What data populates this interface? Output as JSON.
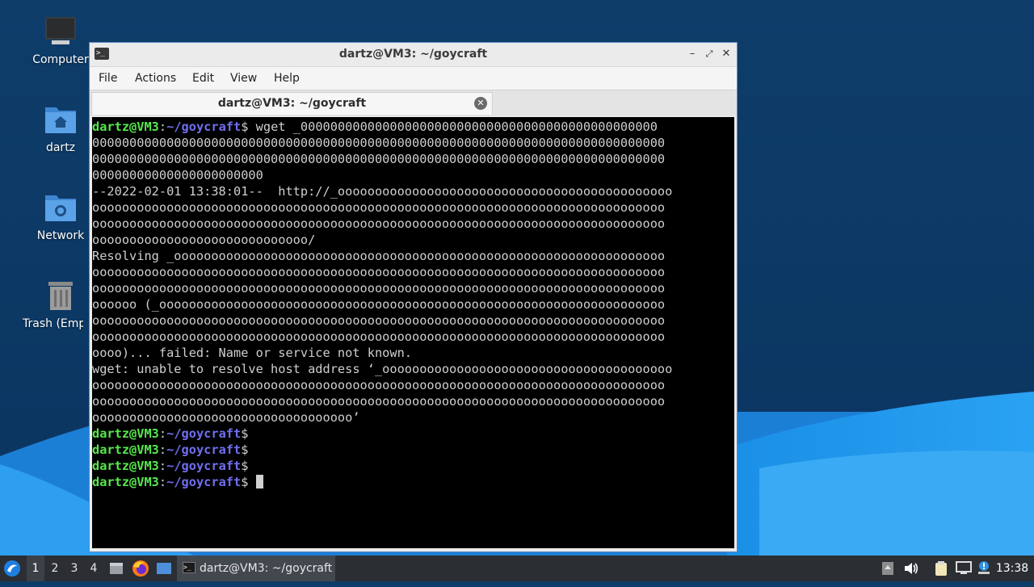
{
  "desktop": {
    "icons": [
      {
        "label": "Computer",
        "icon": "computer-icon"
      },
      {
        "label": "dartz",
        "icon": "home-folder-icon"
      },
      {
        "label": "Network",
        "icon": "network-folder-icon"
      },
      {
        "label": "Trash (Empty)",
        "icon": "trash-icon"
      }
    ]
  },
  "window": {
    "title": "dartz@VM3: ~/goycraft",
    "menu": [
      "File",
      "Actions",
      "Edit",
      "View",
      "Help"
    ],
    "tab_label": "dartz@VM3: ~/goycraft"
  },
  "terminal": {
    "prompt_user": "dartz@VM3",
    "prompt_sep": ":",
    "prompt_path": "~/goycraft",
    "prompt_symbol": "$",
    "command": " wget _000000000000000000000000000000000000000000000000",
    "output": "00000000000000000000000000000000000000000000000000000000000000000000000000000\n00000000000000000000000000000000000000000000000000000000000000000000000000000\n00000000000000000000000\n--2022-02-01 13:38:01--  http://_ooooooooooooooooooooooooooooooooooooooooooooo\nooooooooooooooooooooooooooooooooooooooooooooooooooooooooooooooooooooooooooooo\nooooooooooooooooooooooooooooooooooooooooooooooooooooooooooooooooooooooooooooo\nooooooooooooooooooooooooooooo/\nResolving _oooooooooooooooooooooooooooooooooooooooooooooooooooooooooooooooooo\nooooooooooooooooooooooooooooooooooooooooooooooooooooooooooooooooooooooooooooo\nooooooooooooooooooooooooooooooooooooooooooooooooooooooooooooooooooooooooooooo\noooooo (_oooooooooooooooooooooooooooooooooooooooooooooooooooooooooooooooooooo\nooooooooooooooooooooooooooooooooooooooooooooooooooooooooooooooooooooooooooooo\nooooooooooooooooooooooooooooooooooooooooooooooooooooooooooooooooooooooooooooo\noooo)... failed: Name or service not known.\nwget: unable to resolve host address ‘_ooooooooooooooooooooooooooooooooooooooo\nooooooooooooooooooooooooooooooooooooooooooooooooooooooooooooooooooooooooooooo\nooooooooooooooooooooooooooooooooooooooooooooooooooooooooooooooooooooooooooooo\nooooooooooooooooooooooooooooooooooo’"
  },
  "taskbar": {
    "workspaces": [
      "1",
      "2",
      "3",
      "4"
    ],
    "active_workspace": "1",
    "task_label": "dartz@VM3: ~/goycraft",
    "clock": "13:38",
    "tray_icons": [
      "network-notification-icon",
      "volume-icon",
      "clipboard-icon",
      "display-icon",
      "update-notifier-icon"
    ]
  }
}
